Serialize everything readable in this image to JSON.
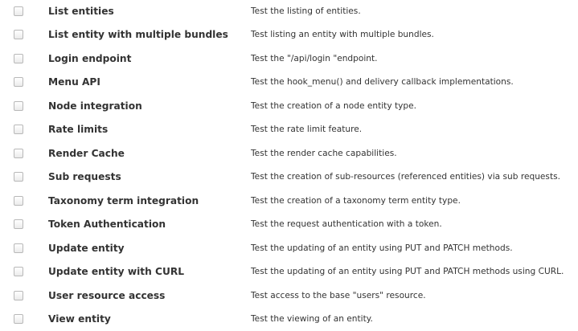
{
  "tests": [
    {
      "name": "List entities",
      "description": "Test the listing of entities."
    },
    {
      "name": "List entity with multiple bundles",
      "description": "Test listing an entity with multiple bundles."
    },
    {
      "name": "Login endpoint",
      "description": "Test the \"/api/login \"endpoint."
    },
    {
      "name": "Menu API",
      "description": "Test the hook_menu() and delivery callback implementations."
    },
    {
      "name": "Node integration",
      "description": "Test the creation of a node entity type."
    },
    {
      "name": "Rate limits",
      "description": "Test the rate limit feature."
    },
    {
      "name": "Render Cache",
      "description": "Test the render cache capabilities."
    },
    {
      "name": "Sub requests",
      "description": "Test the creation of sub-resources (referenced entities) via sub requests."
    },
    {
      "name": "Taxonomy term integration",
      "description": "Test the creation of a taxonomy term entity type."
    },
    {
      "name": "Token Authentication",
      "description": "Test the request authentication with a token."
    },
    {
      "name": "Update entity",
      "description": "Test the updating of an entity using PUT and PATCH methods."
    },
    {
      "name": "Update entity with CURL",
      "description": "Test the updating of an entity using PUT and PATCH methods using CURL."
    },
    {
      "name": "User resource access",
      "description": "Test access to the base \"users\" resource."
    },
    {
      "name": "View entity",
      "description": "Test the viewing of an entity."
    }
  ]
}
